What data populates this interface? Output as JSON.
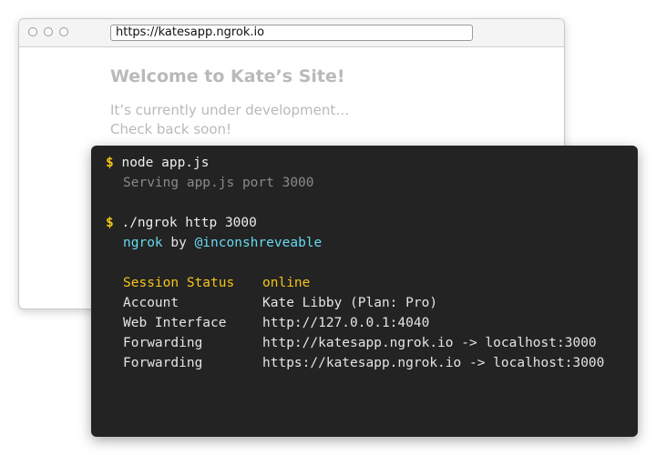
{
  "browser": {
    "url": "https://katesapp.ngrok.io",
    "page": {
      "title": "Welcome to Kate’s Site!",
      "line1": "It’s currently under development…",
      "line2": "Check back soon!"
    }
  },
  "terminal": {
    "prompt": "$",
    "cmd1": "node app.js",
    "out1": "Serving app.js port 3000",
    "cmd2": "./ngrok http 3000",
    "credit_name": "ngrok",
    "credit_by": " by ",
    "credit_handle": "@inconshreveable",
    "rows": [
      {
        "label": "Session Status",
        "value": "online"
      },
      {
        "label": "Account",
        "value": "Kate Libby (Plan: Pro)"
      },
      {
        "label": "Web Interface",
        "value": "http://127.0.0.1:4040"
      },
      {
        "label": "Forwarding",
        "value": "http://katesapp.ngrok.io -> localhost:3000"
      },
      {
        "label": "Forwarding",
        "value": "https://katesapp.ngrok.io -> localhost:3000"
      }
    ]
  },
  "colors": {
    "terminal_bg": "#232323",
    "prompt": "#f5c518",
    "link": "#66d9ef",
    "muted": "#8a8a8a"
  }
}
